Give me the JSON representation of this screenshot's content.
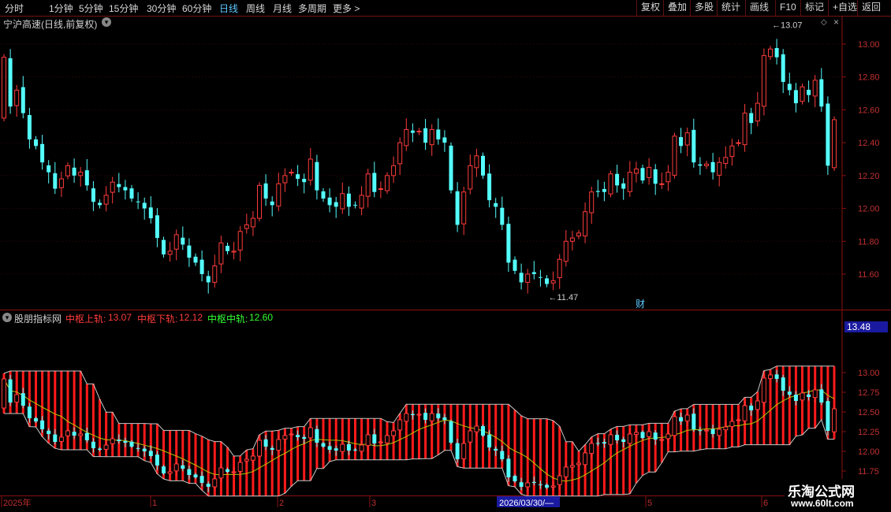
{
  "toolbar": {
    "left": [
      "分时",
      "1分钟",
      "5分钟",
      "15分钟",
      "30分钟",
      "60分钟",
      "日线",
      "周线",
      "月线",
      "多周期",
      "更多 >"
    ],
    "active": "日线",
    "right": [
      "复权",
      "叠加",
      "多股",
      "统计",
      "画线",
      "F10",
      "标记",
      "+自选",
      "返回"
    ]
  },
  "main_panel": {
    "title": "宁沪高速(日线,前复权)",
    "high_marker": "13.07",
    "low_marker": "11.47",
    "fin_marker": "财",
    "y_ticks": [
      "13.00",
      "12.80",
      "12.60",
      "12.40",
      "12.20",
      "12.00",
      "11.80",
      "11.60"
    ]
  },
  "sub_panel": {
    "indicator_name": "股朋指标网",
    "upper_label": "中枢上轨:",
    "upper_value": "13.07",
    "lower_label": "中枢下轨:",
    "lower_value": "12.12",
    "mid_label": "中枢中轨:",
    "mid_value": "12.60",
    "current_value": "13.48",
    "y_ticks": [
      "13.00",
      "12.75",
      "12.50",
      "12.25",
      "12.00",
      "11.75"
    ]
  },
  "x_axis": {
    "labels": [
      "2025年",
      "1",
      "2",
      "3",
      "2026/03/30/—",
      "5",
      "6"
    ]
  },
  "watermark": {
    "line1": "乐淘公式网",
    "line2": "www.60lt.com"
  },
  "colors": {
    "up": "#ff3b3b",
    "down": "#54ffff",
    "band": "#ff1a1a",
    "mid_line": "#b8c400",
    "ma": "#d0d000"
  },
  "chart_data": {
    "type": "candlestick",
    "closes": [
      12.92,
      12.62,
      12.72,
      12.58,
      12.42,
      12.38,
      12.28,
      12.22,
      12.12,
      12.18,
      12.26,
      12.2,
      12.22,
      12.14,
      12.04,
      12.02,
      12.08,
      12.16,
      12.13,
      12.11,
      12.06,
      12.04,
      12.0,
      11.94,
      11.82,
      11.72,
      11.74,
      11.84,
      11.78,
      11.7,
      11.67,
      11.6,
      11.55,
      11.65,
      11.79,
      11.74,
      11.74,
      11.86,
      11.9,
      11.94,
      12.14,
      12.06,
      12.02,
      12.15,
      12.2,
      12.22,
      12.18,
      12.16,
      12.3,
      12.11,
      12.06,
      12.02,
      12.01,
      12.09,
      12.01,
      12.02,
      12.08,
      12.21,
      12.1,
      12.12,
      12.2,
      12.26,
      12.4,
      12.48,
      12.46,
      12.47,
      12.4,
      12.48,
      12.42,
      12.4,
      12.11,
      11.9,
      12.1,
      12.26,
      12.32,
      12.2,
      12.05,
      12.01,
      11.9,
      11.67,
      11.62,
      11.55,
      11.6,
      11.6,
      11.58,
      11.54,
      11.56,
      11.69,
      11.8,
      11.82,
      11.85,
      11.98,
      12.1,
      12.1,
      12.1,
      12.21,
      12.14,
      12.12,
      12.22,
      12.24,
      12.17,
      12.25,
      12.15,
      12.15,
      12.22,
      12.44,
      12.38,
      12.46,
      12.28,
      12.26,
      12.27,
      12.22,
      12.28,
      12.31,
      12.38,
      12.4,
      12.58,
      12.52,
      12.64,
      12.93,
      12.97,
      12.92,
      12.77,
      12.72,
      12.64,
      12.74,
      12.69,
      12.78,
      12.62,
      12.26,
      12.54
    ]
  }
}
